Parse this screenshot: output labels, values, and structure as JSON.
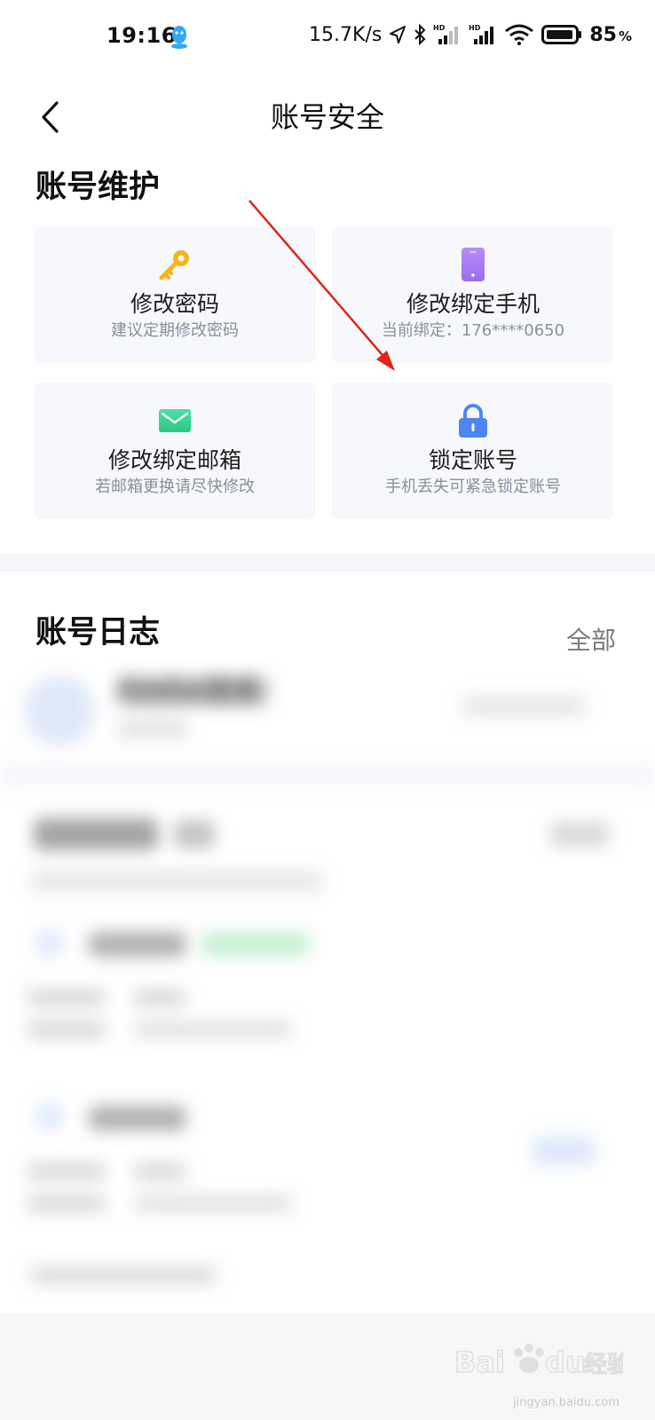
{
  "status_bar": {
    "time": "19:16",
    "net_speed": "15.7K/s",
    "battery": "85",
    "battery_unit": "%",
    "net_badge": "HD"
  },
  "header": {
    "title": "账号安全"
  },
  "maintenance": {
    "title": "账号维护",
    "cards": [
      {
        "title": "修改密码",
        "subtitle": "建议定期修改密码",
        "icon": "key-icon"
      },
      {
        "title": "修改绑定手机",
        "subtitle": "当前绑定：176****0650",
        "icon": "phone-icon"
      },
      {
        "title": "修改绑定邮箱",
        "subtitle": "若邮箱更换请尽快修改",
        "icon": "mail-icon"
      },
      {
        "title": "锁定账号",
        "subtitle": "手机丢失可紧急锁定账号",
        "icon": "lock-icon"
      }
    ]
  },
  "log": {
    "title": "账号日志",
    "all_label": "全部",
    "first_entry": "Firefox登录"
  },
  "watermark": {
    "caption": "jingyan.baidu.com"
  },
  "colors": {
    "key": "#f5b418",
    "phone": "#a97ef5",
    "mail": "#35d28f",
    "lock": "#4d86f2",
    "card_bg": "#f6f8fc",
    "arrow": "#e0241c"
  }
}
